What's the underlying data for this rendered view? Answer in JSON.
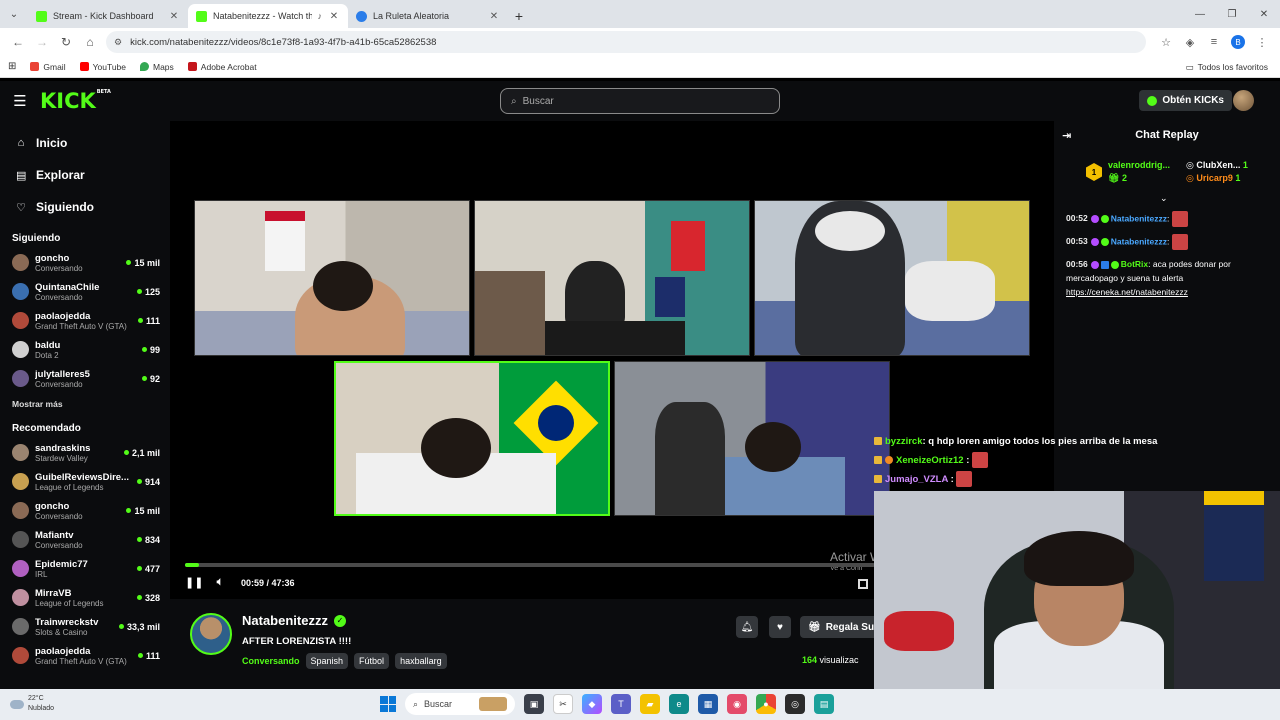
{
  "browser": {
    "tabs": [
      {
        "title": "Stream - Kick Dashboard",
        "color": "#53fc18"
      },
      {
        "title": "Natabenitezzz - Watch the",
        "color": "#53fc18"
      },
      {
        "title": "La Ruleta Aleatoria",
        "color": "#2b7de9"
      }
    ],
    "url": "kick.com/natabenitezzz/videos/8c1e73f8-1a93-4f7b-a41b-65ca52862538",
    "bookmarks": [
      "Gmail",
      "YouTube",
      "Maps",
      "Adobe Acrobat"
    ],
    "all_bookmarks": "Todos los favoritos",
    "profile_initial": "B"
  },
  "header": {
    "logo": "KICK",
    "logo_sup": "BETA",
    "search_placeholder": "Buscar",
    "kicks_button": "Obtén KICKs"
  },
  "sidebar": {
    "nav": [
      {
        "label": "Inicio",
        "icon": "home-icon"
      },
      {
        "label": "Explorar",
        "icon": "compass-icon"
      },
      {
        "label": "Siguiendo",
        "icon": "heart-icon"
      }
    ],
    "following_title": "Siguiendo",
    "following": [
      {
        "name": "goncho",
        "category": "Conversando",
        "viewers": "15 mil",
        "color": "#8a6a55"
      },
      {
        "name": "QuintanaChile",
        "category": "Conversando",
        "viewers": "125",
        "color": "#3a6fb0"
      },
      {
        "name": "paolaojedda",
        "category": "Grand Theft Auto V (GTA)",
        "viewers": "111",
        "color": "#b04a3a"
      },
      {
        "name": "baldu",
        "category": "Dota 2",
        "viewers": "99",
        "color": "#d0d0d0"
      },
      {
        "name": "julytalleres5",
        "category": "Conversando",
        "viewers": "92",
        "color": "#6a5a8a"
      }
    ],
    "show_more": "Mostrar más",
    "recommended_title": "Recomendado",
    "recommended": [
      {
        "name": "sandraskins",
        "category": "Stardew Valley",
        "viewers": "2,1 mil",
        "color": "#9a8470"
      },
      {
        "name": "GuibelReviewsDire...",
        "category": "League of Legends",
        "viewers": "914",
        "color": "#c8a050"
      },
      {
        "name": "goncho",
        "category": "Conversando",
        "viewers": "15 mil",
        "color": "#8a6a55"
      },
      {
        "name": "Mafiantv",
        "category": "Conversando",
        "viewers": "834",
        "color": "#555"
      },
      {
        "name": "Epidemic77",
        "category": "IRL",
        "viewers": "477",
        "color": "#b060c0"
      },
      {
        "name": "MirraVB",
        "category": "League of Legends",
        "viewers": "328",
        "color": "#c090a0"
      },
      {
        "name": "Trainwreckstv",
        "category": "Slots & Casino",
        "viewers": "33,3 mil",
        "color": "#6a6a6a"
      },
      {
        "name": "paolaojedda",
        "category": "Grand Theft Auto V (GTA)",
        "viewers": "111",
        "color": "#b04a3a"
      }
    ]
  },
  "player": {
    "progress": 0.021,
    "time": "00:59 / 47:36",
    "activate_line1": "Activar W",
    "activate_line2": "Ve a Confi"
  },
  "stream": {
    "streamer": "Natabenitezzz",
    "title": "AFTER LORENZISTA !!!!",
    "category": "Conversando",
    "tags": [
      "Spanish",
      "Fútbol",
      "haxballarg"
    ],
    "gift_label": "Regala Su",
    "viewers": "164",
    "viewers_suffix": " visualizac"
  },
  "chat": {
    "title": "Chat Replay",
    "pinned_rank": "1",
    "pinned": [
      {
        "user": "valenroddrig...",
        "count": "2"
      },
      {
        "user": "ClubXen...",
        "count": "1"
      },
      {
        "user": "Uricarp9",
        "count": "1"
      }
    ],
    "messages": [
      {
        "time": "00:52",
        "user": "Natabenitezzz",
        "text": ":"
      },
      {
        "time": "00:53",
        "user": "Natabenitezzz",
        "text": ":"
      },
      {
        "time": "00:56",
        "user": "BotRix",
        "text": ": aca podes donar por mercadopago y suena tu alerta",
        "link": "https://ceneka.net/natabenitezzz"
      }
    ]
  },
  "overlay_chat": [
    {
      "user": "byzzirck",
      "text": ": q hdp loren amigo todos los pies arriba de la mesa",
      "color": "#53fc18"
    },
    {
      "user": "XeneizeOrtiz12",
      "text": ":",
      "color": "#53fc18"
    },
    {
      "user": "Jumajo_VZLA",
      "text": ":",
      "color": "#d08cff"
    }
  ],
  "taskbar": {
    "temp": "22°C",
    "weather": "Nublado",
    "search": "Buscar"
  }
}
